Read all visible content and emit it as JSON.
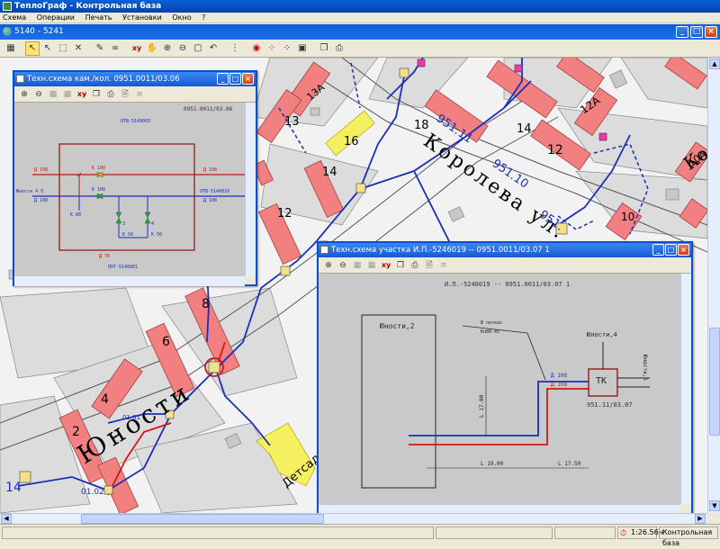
{
  "window": {
    "title": "ТеплоГраф - Контрольная база",
    "doc_title": "5140 - 5241"
  },
  "menu": [
    "Схема",
    "Операции",
    "Печать",
    "Установки",
    "Окно",
    "?"
  ],
  "toolbar_icons": [
    "layers-icon",
    "select-arrow-icon",
    "select-arrow-plus-icon",
    "select-rect-icon",
    "delete-select-icon",
    "edit-pencil-icon",
    "lookup-binoculars-icon",
    "xy-icon",
    "hand-pan-icon",
    "zoom-in-icon",
    "zoom-out-icon",
    "zoom-box-icon",
    "undo-zoom-icon",
    "traffic-icon",
    "eye-icon",
    "points-red-icon",
    "points-blue-icon",
    "image-icon",
    "copy-icon",
    "print-icon"
  ],
  "map": {
    "streets": {
      "koroleva": "Королева ул.",
      "yunosti": "Юности",
      "yunosti_short": "Юности"
    },
    "buildings": {
      "b13a": "13А",
      "b13": "13",
      "b16": "16",
      "b18": "18",
      "b14": "14",
      "b12a": "12А",
      "b12": "12",
      "b14b": "14",
      "b12b": "12",
      "b10": "10",
      "b10a": "10А",
      "b8": "8",
      "b6": "6",
      "b4": "4",
      "b2": "2",
      "b14c": "14"
    },
    "labels": {
      "l951_11": "951.11",
      "l951_10": "951.10",
      "l951_13": "951.",
      "detsad": "Детсад",
      "kor_k": "Ко",
      "l01_02": "01.02",
      "l01_01": "01.01"
    }
  },
  "subwin1": {
    "title": "Техн.схема кам./кол. 0951.0011/03.06",
    "code": "0951.0011/03.06",
    "labels": {
      "top": "ОТВ-5140003",
      "bottom": "ПОТ-5140001",
      "right_top": "ОТВ-5140010",
      "left": "Юности 4  0",
      "d108a": "Д 108",
      "d108b": "Д 108",
      "d108c": "Д 108",
      "d108d": "Д 108",
      "k100a": "К 100",
      "k100b": "К 100",
      "k80": "К 80",
      "d76": "Д 76",
      "n3": "3",
      "n4": "4",
      "k50a": "К 50",
      "k50b": "К 50"
    }
  },
  "subwin2": {
    "title": "Техн.схема участка И.П.-5246019 -- 0951.0011/03.07  1",
    "heading": "И.П.-5246019 -- 0951.0011/03.07  1",
    "building": "Юности,2",
    "building2": "Юности,4",
    "building3": "Юности,6",
    "note1": "В потках",
    "note2": "Кп80-45",
    "tk": "ТК",
    "tk_code": "951.11/03.07",
    "d108a": "Д 108",
    "d108b": "Д 108",
    "len_vert": "L 17.00",
    "len1": "L 19.00",
    "len2": "L 17.50"
  },
  "status": {
    "time": "1:26.56н",
    "base": "Контрольная база"
  },
  "colors": {
    "building_fill": "#f28080",
    "pipe_blue": "#1a2fb8",
    "pipe_red": "#d01818",
    "title_blue": "#0a5fd8",
    "highlight_yellow": "#f5f060"
  }
}
